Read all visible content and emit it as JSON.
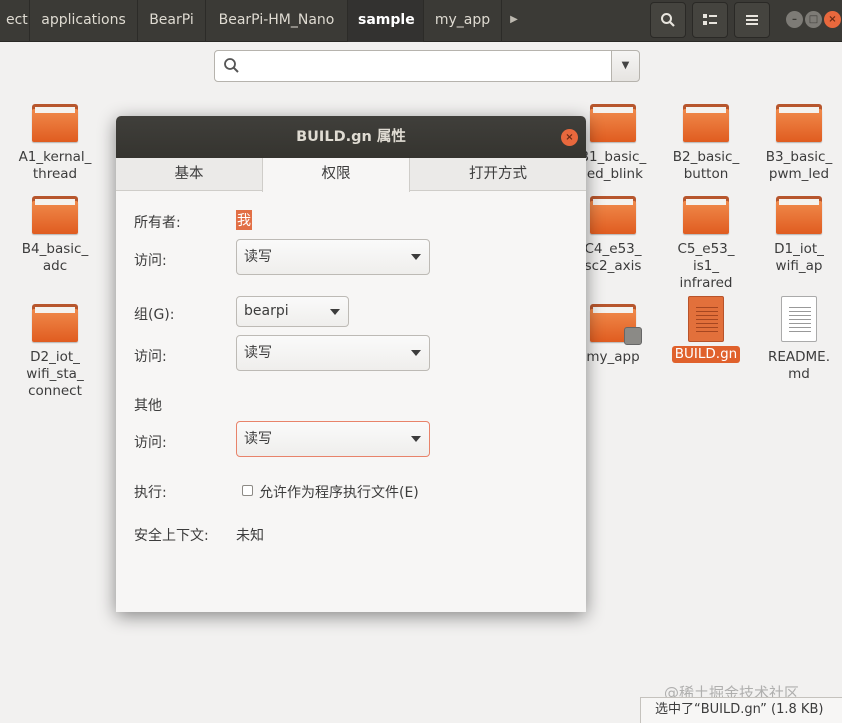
{
  "pathbar": {
    "crumbs": [
      "ect",
      "applications",
      "BearPi",
      "BearPi-HM_Nano",
      "sample",
      "my_app"
    ],
    "active_crumb": "sample",
    "more_arrow": "▶"
  },
  "toolbar": {
    "search_icon": "search-icon",
    "view_icon": "view-toggle-icon",
    "menu_icon": "hamburger-menu-icon"
  },
  "search": {
    "value": "",
    "dropdown_icon": "chevron-down-icon"
  },
  "files": [
    {
      "name": "A1_kernal_\nthread",
      "kind": "folder"
    },
    {
      "name": "B1_basic_\nled_blink",
      "kind": "folder"
    },
    {
      "name": "B2_basic_\nbutton",
      "kind": "folder"
    },
    {
      "name": "B3_basic_\npwm_led",
      "kind": "folder"
    },
    {
      "name": "B4_basic_\nadc",
      "kind": "folder"
    },
    {
      "name": "C4_e53_\nsc2_axis",
      "kind": "folder"
    },
    {
      "name": "C5_e53_\nis1_\ninfrared",
      "kind": "folder"
    },
    {
      "name": "D1_iot_\nwifi_ap",
      "kind": "folder"
    },
    {
      "name": "D2_iot_\nwifi_sta_\nconnect",
      "kind": "folder"
    },
    {
      "name": "my_app",
      "kind": "folder-locked"
    },
    {
      "name": "BUILD.gn",
      "kind": "file-selected"
    },
    {
      "name": "README.\nmd",
      "kind": "file"
    }
  ],
  "dialog": {
    "title": "BUILD.gn 属性",
    "tabs": [
      "基本",
      "权限",
      "打开方式"
    ],
    "active_tab": "权限",
    "owner_label": "所有者:",
    "owner_value": "我",
    "owner_access_label": "访问:",
    "owner_access_value": "读写",
    "group_label": "组(G):",
    "group_value": "bearpi",
    "group_access_label": "访问:",
    "group_access_value": "读写",
    "others_heading": "其他",
    "others_access_label": "访问:",
    "others_access_value": "读写",
    "execute_label": "执行:",
    "execute_checkbox_label": "允许作为程序执行文件(E)",
    "execute_checked": false,
    "security_context_label": "安全上下文:",
    "security_context_value": "未知"
  },
  "statusbar": {
    "text": "选中了“BUILD.gn” (1.8 KB)"
  },
  "watermark": "@稀土掘金技术社区",
  "colors": {
    "accent": "#e0612c",
    "titlebar": "#3b3a36",
    "close": "#e8683d"
  }
}
